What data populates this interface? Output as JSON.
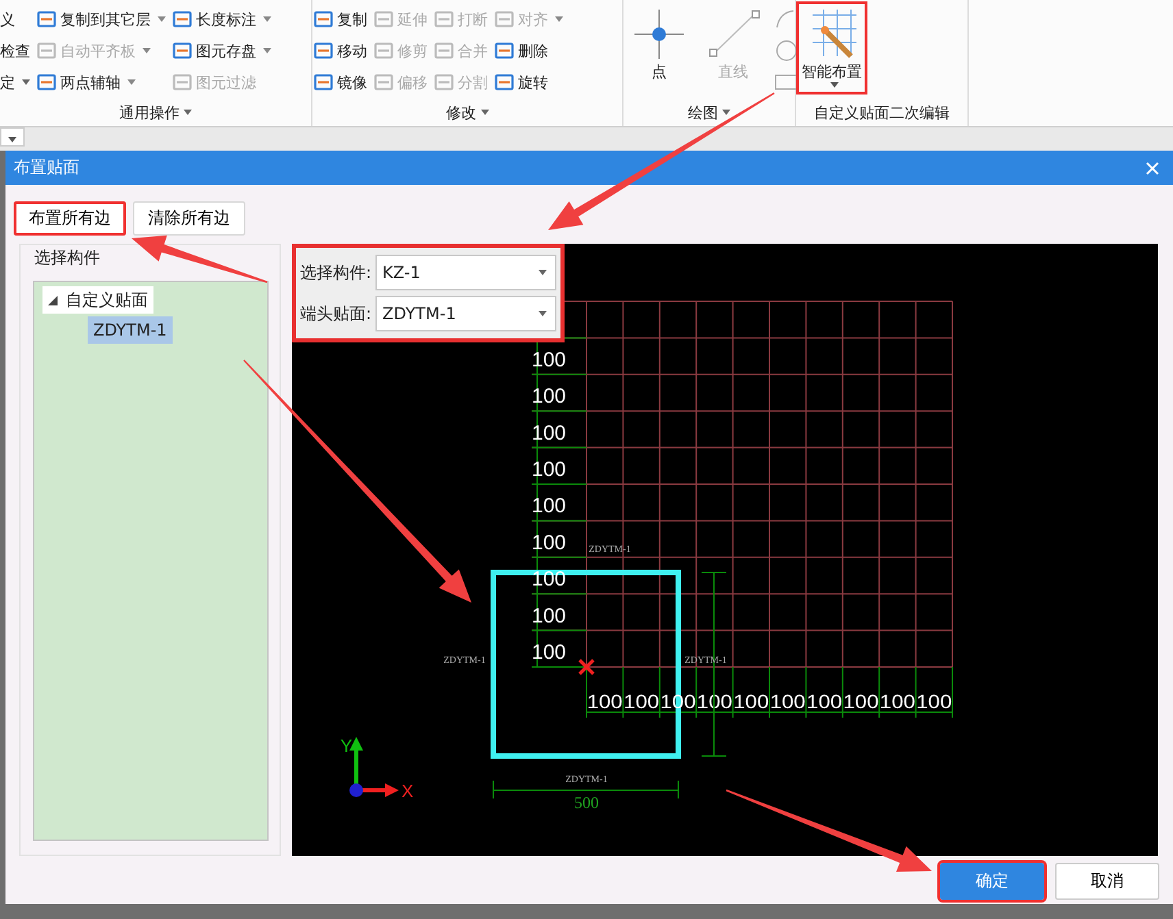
{
  "ribbon": {
    "groups": [
      {
        "label": "通用操作",
        "caret": true,
        "columns": [
          [
            {
              "kind": "text",
              "label": "义",
              "disabled": false,
              "caret": false
            },
            {
              "kind": "text",
              "label": "检查",
              "disabled": false,
              "caret": false
            },
            {
              "kind": "text",
              "label": "定",
              "disabled": false,
              "caret": true
            }
          ],
          [
            {
              "kind": "small",
              "label": "复制到其它层",
              "disabled": false,
              "caret": true
            },
            {
              "kind": "small",
              "label": "自动平齐板",
              "disabled": true,
              "caret": true
            },
            {
              "kind": "small",
              "label": "两点辅轴",
              "disabled": false,
              "caret": true
            }
          ],
          [
            {
              "kind": "small",
              "label": "长度标注",
              "disabled": false,
              "caret": true
            },
            {
              "kind": "small",
              "label": "图元存盘",
              "disabled": false,
              "caret": true
            },
            {
              "kind": "small",
              "label": "图元过滤",
              "disabled": true,
              "caret": false
            }
          ]
        ]
      },
      {
        "label": "修改",
        "caret": true,
        "columns": [
          [
            {
              "kind": "small",
              "label": "复制",
              "disabled": false,
              "caret": false
            },
            {
              "kind": "small",
              "label": "移动",
              "disabled": false,
              "caret": false
            },
            {
              "kind": "small",
              "label": "镜像",
              "disabled": false,
              "caret": false
            }
          ],
          [
            {
              "kind": "small",
              "label": "延伸",
              "disabled": true,
              "caret": false
            },
            {
              "kind": "small",
              "label": "修剪",
              "disabled": true,
              "caret": false
            },
            {
              "kind": "small",
              "label": "偏移",
              "disabled": true,
              "caret": false
            }
          ],
          [
            {
              "kind": "small",
              "label": "打断",
              "disabled": true,
              "caret": false
            },
            {
              "kind": "small",
              "label": "合并",
              "disabled": true,
              "caret": false
            },
            {
              "kind": "small",
              "label": "分割",
              "disabled": true,
              "caret": false
            }
          ],
          [
            {
              "kind": "small",
              "label": "对齐",
              "disabled": true,
              "caret": true
            },
            {
              "kind": "small",
              "label": "删除",
              "disabled": false,
              "caret": false
            },
            {
              "kind": "small",
              "label": "旋转",
              "disabled": false,
              "caret": false
            }
          ]
        ]
      },
      {
        "label": "绘图",
        "caret": true,
        "columns": [
          [
            {
              "kind": "large",
              "label": "点",
              "disabled": false,
              "caret": false,
              "highlighted": false
            }
          ],
          [
            {
              "kind": "large",
              "label": "直线",
              "disabled": true,
              "caret": false,
              "highlighted": false
            }
          ],
          [
            {
              "kind": "icon",
              "disabled": true
            },
            {
              "kind": "icon",
              "disabled": true
            },
            {
              "kind": "icon",
              "disabled": true
            }
          ]
        ]
      },
      {
        "label": "自定义贴面二次编辑",
        "caret": false,
        "columns": [
          [
            {
              "kind": "large",
              "label": "智能布置",
              "disabled": false,
              "caret": true,
              "highlighted": true
            }
          ]
        ]
      }
    ]
  },
  "dialog": {
    "title": "布置贴面",
    "top_buttons": [
      {
        "label": "布置所有边",
        "highlighted": true
      },
      {
        "label": "清除所有边",
        "highlighted": false
      }
    ],
    "group_label": "选择构件",
    "tree": [
      {
        "label": "自定义贴面",
        "expanded": true,
        "selected": false,
        "children": [
          {
            "label": "ZDYTM-1",
            "selected": true
          }
        ]
      }
    ],
    "selectors": {
      "highlighted": true,
      "fields": [
        {
          "label": "选择构件:",
          "value": "KZ-1"
        },
        {
          "label": "端头贴面:",
          "value": "ZDYTM-1"
        }
      ]
    },
    "canvas": {
      "vertical_dims": [
        "100",
        "100",
        "100",
        "100",
        "100",
        "100",
        "100",
        "100",
        "100"
      ],
      "horizontal_dims": [
        "100",
        "100",
        "100",
        "100",
        "100",
        "100",
        "100",
        "100",
        "100",
        "100"
      ],
      "face_labels": [
        "ZDYTM-1",
        "ZDYTM-1",
        "ZDYTM-1",
        "ZDYTM-1"
      ],
      "width_dim": "500",
      "axis_labels": [
        "Y",
        "X"
      ]
    },
    "footer_buttons": [
      {
        "label": "确定",
        "kind": "primary",
        "highlighted": true
      },
      {
        "label": "取消",
        "kind": "default",
        "highlighted": false
      }
    ]
  }
}
